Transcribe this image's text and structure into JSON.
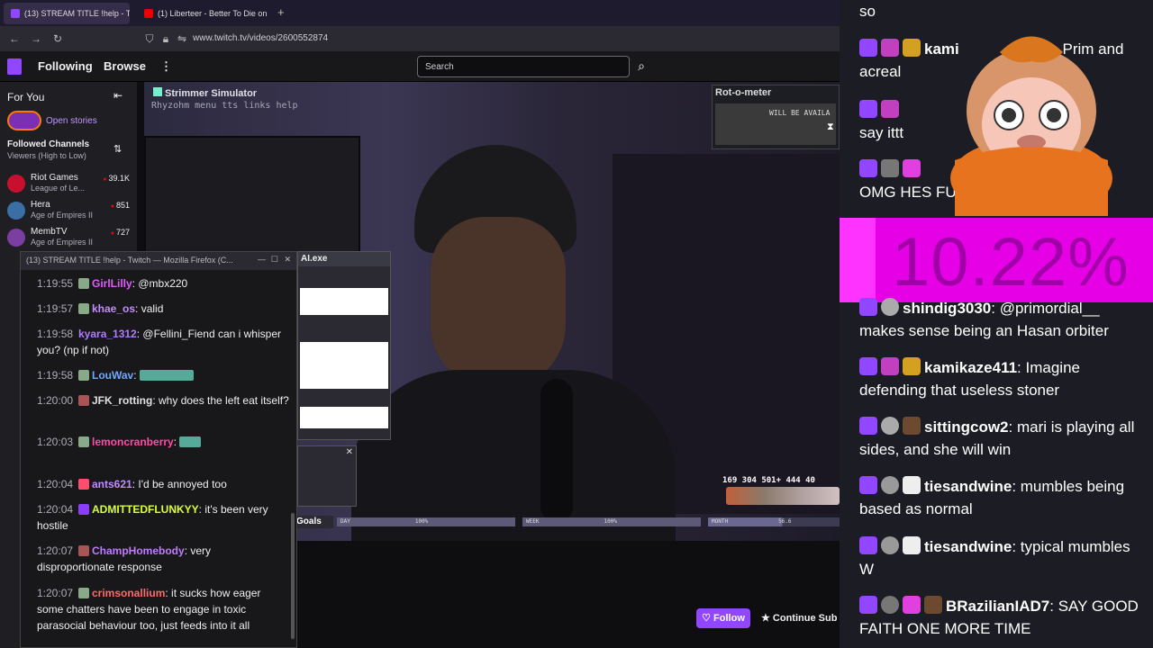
{
  "browser": {
    "tabs": [
      {
        "label": "(13) STREAM TITLE !help - T",
        "active": true
      },
      {
        "label": "(1) Liberteer - Better To Die on",
        "active": false
      }
    ],
    "url": "www.twitch.tv/videos/2600552874"
  },
  "topnav": {
    "following": "Following",
    "browse": "Browse",
    "search_placeholder": "Search"
  },
  "sidebar": {
    "for_you": "For You",
    "open_stories": "Open stories",
    "followed_title": "Followed Channels",
    "sort": "Viewers (High to Low)",
    "channels": [
      {
        "name": "Riot Games",
        "game": "League of Le...",
        "viewers": "39.1K",
        "color": "#c8102e"
      },
      {
        "name": "Hera",
        "game": "Age of Empires II",
        "viewers": "851",
        "color": "#3a6ea5"
      },
      {
        "name": "MembTV",
        "game": "Age of Empires II",
        "viewers": "727",
        "color": "#7a3fa0"
      }
    ]
  },
  "video": {
    "overlay_title": "Strimmer Simulator",
    "overlay_menu": "Rhyzohm menu tts links help",
    "rot_title": "Rot-o-meter",
    "rot_text": "WILL BE AVAILA",
    "ai_window": "AI.exe",
    "goals_label": "Goals",
    "goal_day": "DAY",
    "goal_day_val": "100%",
    "goal_week": "WEEK",
    "goal_week_val": "100%",
    "goal_month": "MONTH",
    "goal_month_val": "56.6",
    "counters": "169 304 501+ 444 40",
    "follow": "Follow",
    "continue_sub": "Continue Sub"
  },
  "popup": {
    "title": "(13) STREAM TITLE !help - Twitch — Mozilla Firefox (C...",
    "messages": [
      {
        "ts": "1:19:55",
        "user": "GirlLilly",
        "color": "#e05cff",
        "text": "@mbx220"
      },
      {
        "ts": "1:19:57",
        "user": "khae_os",
        "color": "#c48cff",
        "text": "valid"
      },
      {
        "ts": "1:19:58",
        "user": "kyara_1312",
        "color": "#b07bff",
        "text": "@Fellini_Fiend can i whisper you? (np if not)"
      },
      {
        "ts": "1:19:58",
        "user": "LouWav",
        "color": "#6fa8ff",
        "text": ""
      },
      {
        "ts": "1:20:00",
        "user": "JFK_rotting",
        "color": "#e0e0e0",
        "text": "why does the left eat itself?"
      },
      {
        "ts": "1:20:03",
        "user": "lemoncranberry",
        "color": "#ff4da6",
        "text": ""
      },
      {
        "ts": "1:20:04",
        "user": "ants621",
        "color": "#c08cff",
        "text": "I'd be annoyed too"
      },
      {
        "ts": "1:20:04",
        "user": "ADMITTEDFLUNKYY",
        "color": "#d8ff3a",
        "text": "it's been very hostile"
      },
      {
        "ts": "1:20:07",
        "user": "ChampHomebody",
        "color": "#c07bff",
        "text": "very disproportionate response"
      },
      {
        "ts": "1:20:07",
        "user": "crimsonallium",
        "color": "#ff6b6b",
        "text": "it sucks how eager some chatters have been to engage in toxic parasocial behaviour too, just feeds into it all"
      }
    ]
  },
  "right_chat": {
    "percent": "10.22%",
    "messages": [
      {
        "user": "",
        "text": "so"
      },
      {
        "user": "kami",
        "text": "Prim and acreal"
      },
      {
        "user": "",
        "text": "say ittt"
      },
      {
        "user": "",
        "text": "OMG HES FUCKI THAT CO"
      },
      {
        "user": "shindig3030",
        "text": "@primordial__ makes sense being an Hasan orbiter"
      },
      {
        "user": "kamikaze411",
        "text": "Imagine defending that useless stoner"
      },
      {
        "user": "sittingcow2",
        "text": "mari is playing all sides, and she will win"
      },
      {
        "user": "tiesandwine",
        "text": "mumbles being based as normal"
      },
      {
        "user": "tiesandwine",
        "text": "typical mumbles W"
      },
      {
        "user": "BRazilianIAD7",
        "text": "SAY GOOD FAITH ONE MORE TIME"
      }
    ]
  }
}
